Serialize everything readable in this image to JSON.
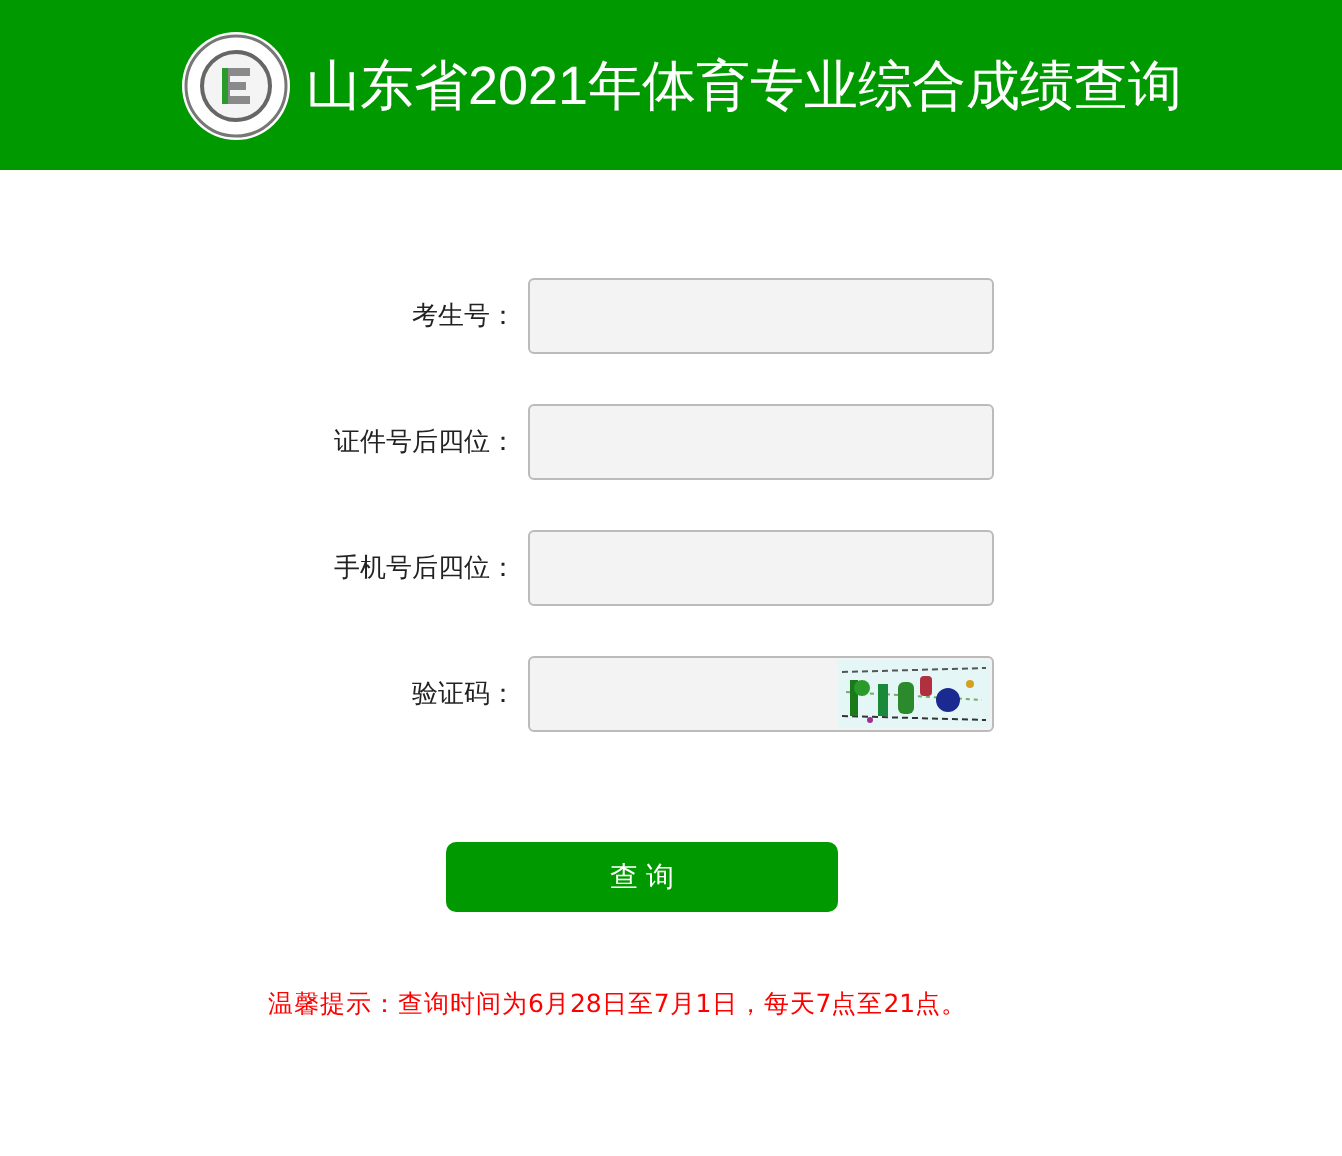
{
  "header": {
    "title": "山东省2021年体育专业综合成绩查询"
  },
  "fields": [
    {
      "label": "考生号：",
      "kind": "text"
    },
    {
      "label": "证件号后四位：",
      "kind": "text"
    },
    {
      "label": "手机号后四位：",
      "kind": "text"
    },
    {
      "label": "验证码：",
      "kind": "captcha"
    }
  ],
  "submit_button": "查 询",
  "notice": "温馨提示：查询时间为6月28日至7月1日，每天7点至21点。"
}
